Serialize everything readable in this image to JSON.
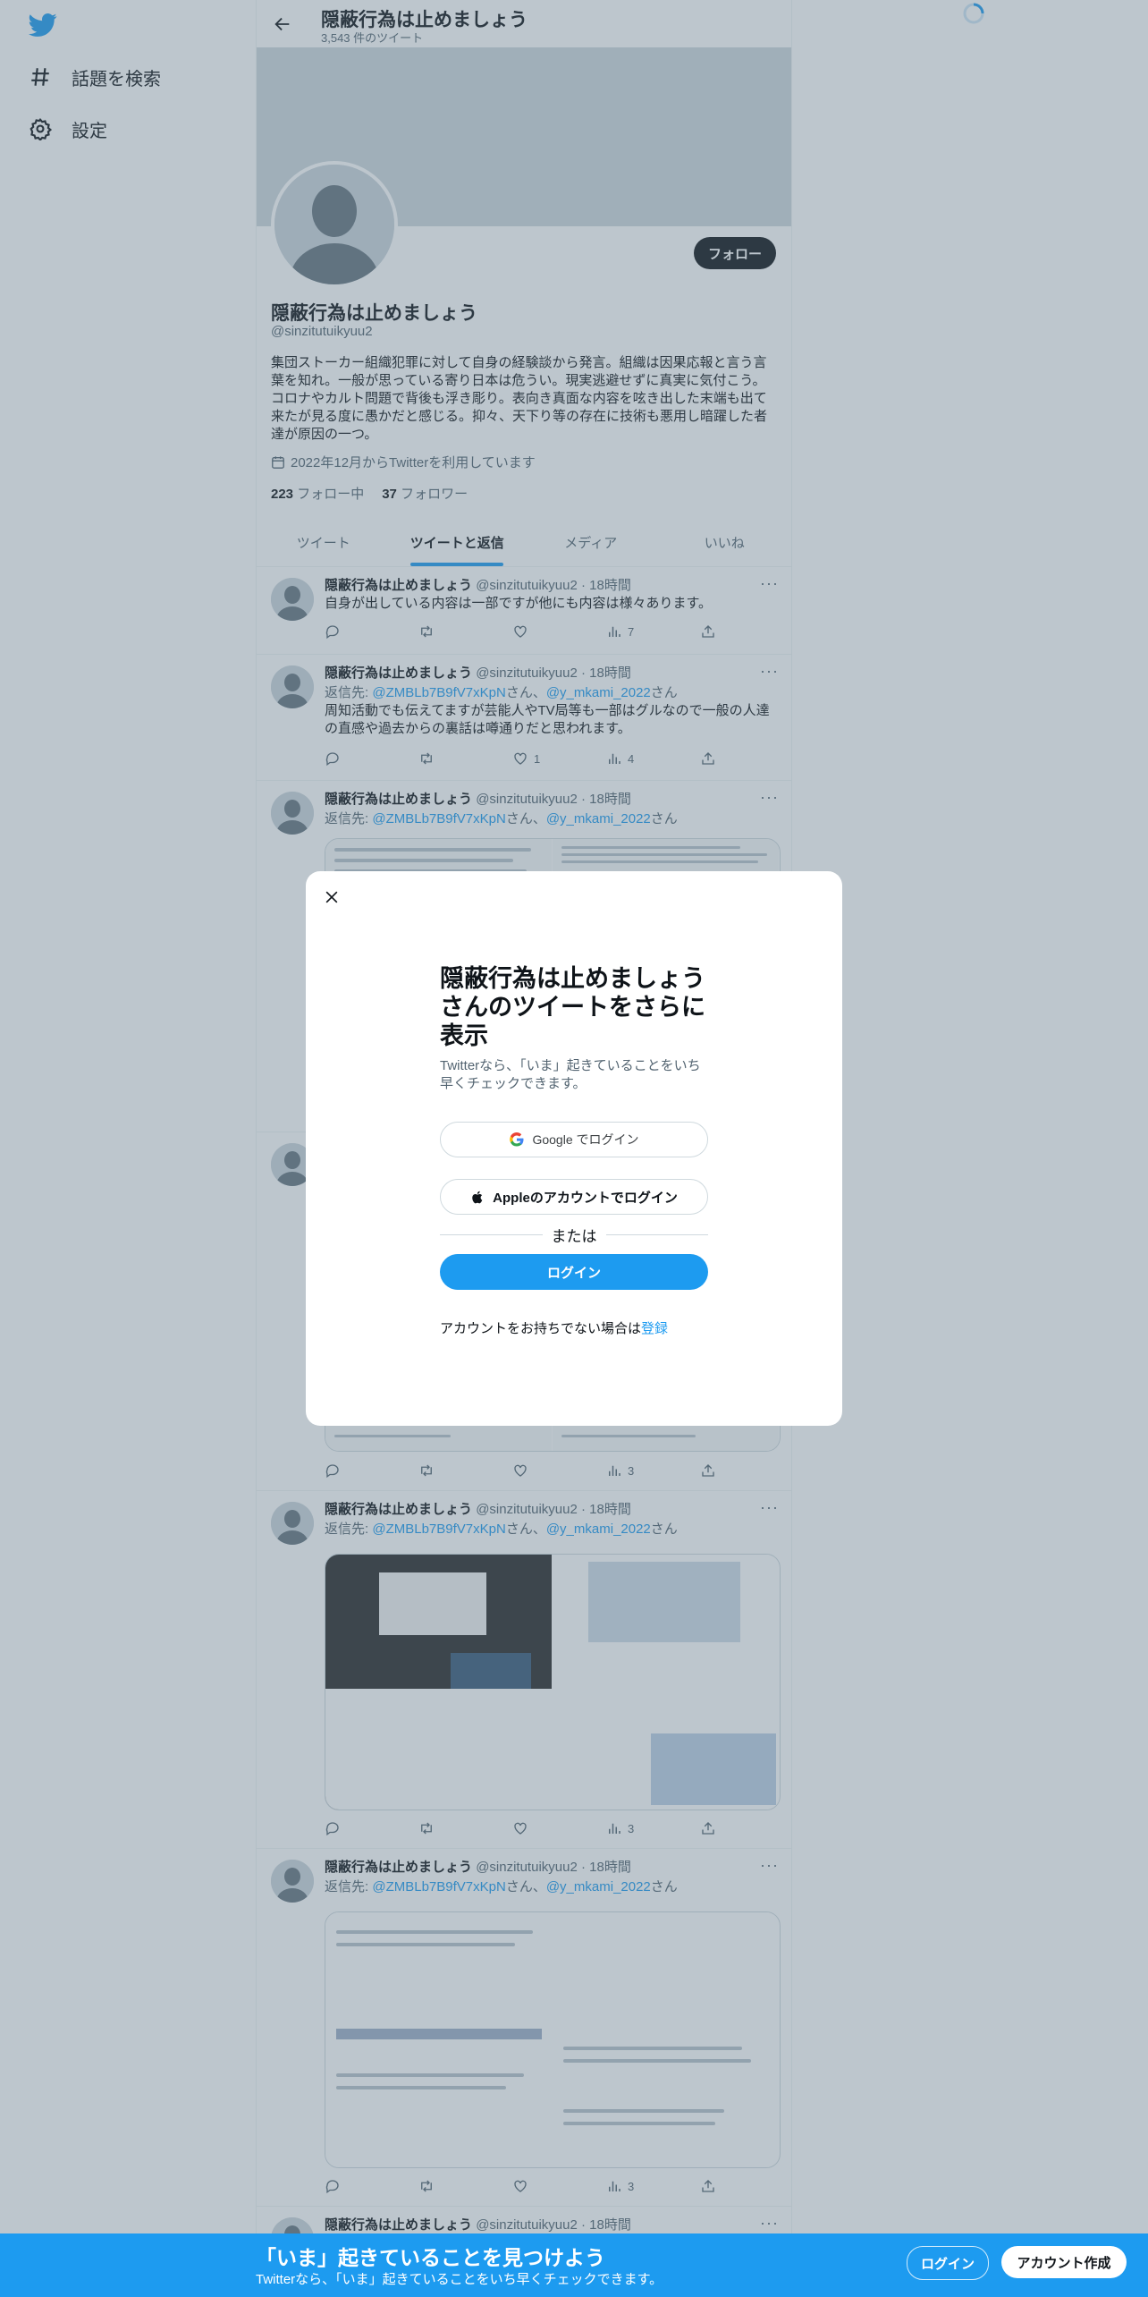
{
  "nav": {
    "explore_label": "話題を検索",
    "settings_label": "設定"
  },
  "header": {
    "title": "隠蔽行為は止めましょう",
    "tweet_count": "3,543 件のツイート"
  },
  "profile": {
    "name": "隠蔽行為は止めましょう",
    "handle": "@sinzitutuikyuu2",
    "follow_label": "フォロー",
    "bio": "集団ストーカー組織犯罪に対して自身の経験談から発言。組織は因果応報と言う言葉を知れ。一般が思っている寄り日本は危うい。現実逃避せずに真実に気付こう。コロナやカルト問題で背後も浮き彫り。表向き真面な内容を呟き出した末端も出て来たが見る度に愚かだと感じる。抑々、天下り等の存在に技術も悪用し暗躍した者達が原因の一つ。",
    "joined": "2022年12月からTwitterを利用しています",
    "following_count": "223",
    "following_label": "フォロー中",
    "followers_count": "37",
    "followers_label": "フォロワー"
  },
  "tabs": [
    {
      "label": "ツイート"
    },
    {
      "label": "ツイートと返信"
    },
    {
      "label": "メディア"
    },
    {
      "label": "いいね"
    }
  ],
  "tweets": [
    {
      "name": "隠蔽行為は止めましょう",
      "handle": "@sinzitutuikyuu2",
      "time": "18時間",
      "text": "自身が出している内容は一部ですが他にも内容は様々あります。",
      "views": "7"
    },
    {
      "name": "隠蔽行為は止めましょう",
      "handle": "@sinzitutuikyuu2",
      "time": "18時間",
      "reply_prefix": "返信先: ",
      "reply_user1": "@ZMBLb7B9fV7xKpN",
      "reply_mid": "さん、",
      "reply_user2": "@y_mkami_2022",
      "reply_suffix": "さん",
      "text": "周知活動でも伝えてますが芸能人やTV局等も一部はグルなので一般の人達の直感や過去からの裏話は噂通りだと思われます。",
      "likes": "1",
      "views": "4"
    },
    {
      "name": "隠蔽行為は止めましょう",
      "handle": "@sinzitutuikyuu2",
      "time": "18時間",
      "reply_prefix": "返信先: ",
      "reply_user1": "@ZMBLb7B9fV7xKpN",
      "reply_mid": "さん、",
      "reply_user2": "@y_mkami_2022",
      "reply_suffix": "さん",
      "views": "3"
    },
    {
      "name": "隠蔽行為は止めましょう",
      "handle": "@sinzitutuikyuu2",
      "time": "18時間",
      "reply_prefix": "返信先: ",
      "reply_user1": "@ZMBLb7B9fV7xKpN",
      "reply_mid": "さん、",
      "reply_user2": "@y_mkami_2022",
      "reply_suffix": "さん",
      "views": "3"
    },
    {
      "name": "隠蔽行為は止めましょう",
      "handle": "@sinzitutuikyuu2",
      "time": "18時間",
      "reply_prefix": "返信先: ",
      "reply_user1": "@ZMBLb7B9fV7xKpN",
      "reply_mid": "さん、",
      "reply_user2": "@y_mkami_2022",
      "reply_suffix": "さん",
      "views": "3"
    },
    {
      "name": "隠蔽行為は止めましょう",
      "handle": "@sinzitutuikyuu2",
      "time": "18時間"
    }
  ],
  "modal": {
    "title": "隠蔽行為は止めましょうさんのツイートをさらに表示",
    "subtitle": "Twitterなら、「いま」起きていることをいち早くチェックできます。",
    "google_label": "Google でログイン",
    "apple_label": "Appleのアカウントでログイン",
    "or_label": "または",
    "login_label": "ログイン",
    "signup_prompt": "アカウントをお持ちでない場合は",
    "signup_link": "登録"
  },
  "bottom_bar": {
    "title": "「いま」起きていることを見つけよう",
    "subtitle": "Twitterなら、「いま」起きていることをいち早くチェックできます。",
    "login_label": "ログイン",
    "signup_label": "アカウント作成"
  },
  "colors": {
    "accent": "#1d9bf0",
    "text": "#0f1419",
    "secondary": "#536471",
    "overlay": "rgba(91,112,131,0.40)"
  },
  "icons": [
    "twitter-logo-icon",
    "hashtag-icon",
    "gear-icon",
    "back-arrow-icon",
    "calendar-icon",
    "reply-icon",
    "retweet-icon",
    "like-icon",
    "views-icon",
    "share-icon",
    "close-icon",
    "google-icon",
    "apple-icon",
    "loading-spinner-icon"
  ]
}
